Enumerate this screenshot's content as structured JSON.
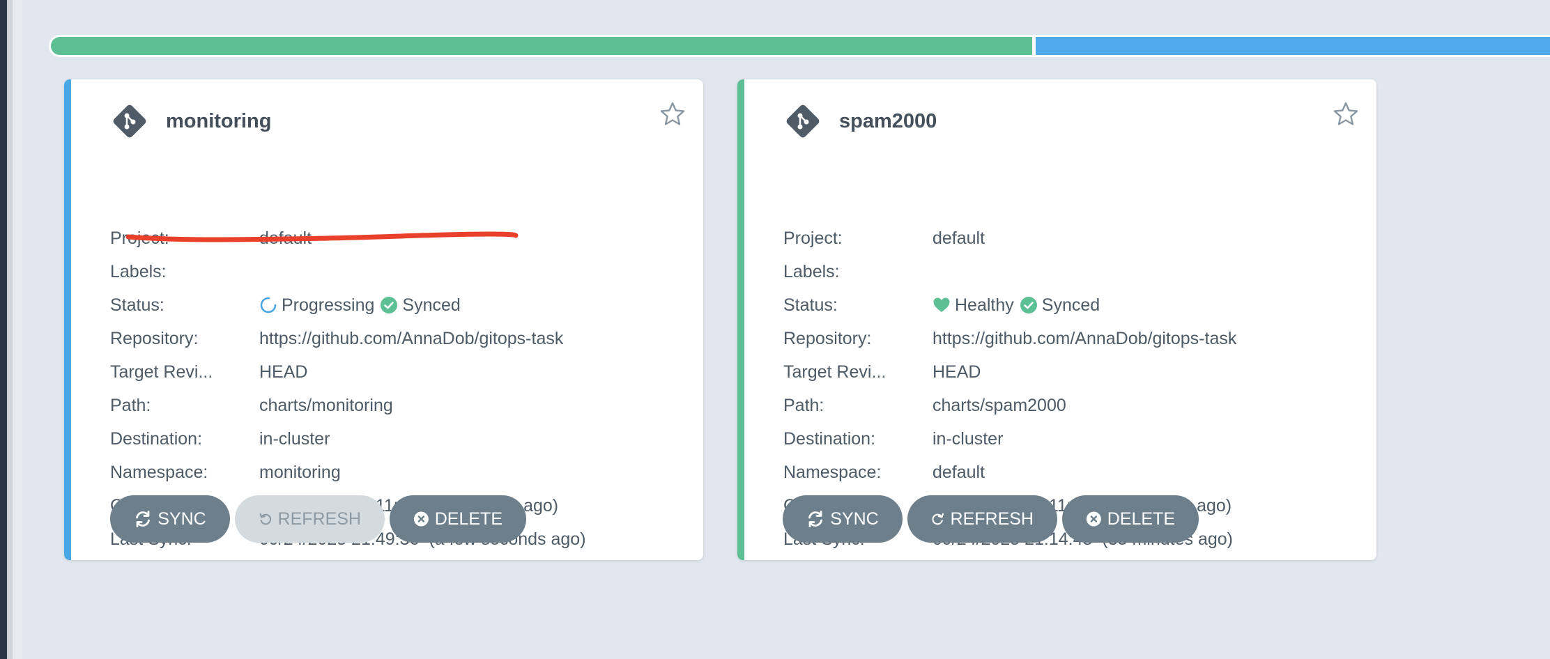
{
  "progress": {
    "segments": [
      {
        "name": "synced",
        "color": "#5dbf94",
        "fraction": 0.655
      },
      {
        "name": "other",
        "color": "#50a9e8",
        "fraction": 0.345
      }
    ]
  },
  "labels": {
    "project": "Project:",
    "labels": "Labels:",
    "status": "Status:",
    "repository": "Repository:",
    "target_revision": "Target Revi...",
    "path": "Path:",
    "destination": "Destination:",
    "namespace": "Namespace:",
    "created_at": "Created At:",
    "last_sync": "Last Sync:"
  },
  "buttons": {
    "sync": "SYNC",
    "refresh": "REFRESH",
    "delete": "DELETE"
  },
  "apps": [
    {
      "name": "monitoring",
      "accent_color": "#4ba6e5",
      "project": "default",
      "labels": "",
      "health_status": "Progressing",
      "health_icon": "progressing-spinner-icon",
      "sync_status": "Synced",
      "repository": "https://github.com/AnnaDob/gitops-task",
      "target_revision": "HEAD",
      "path": "charts/monitoring",
      "destination": "in-cluster",
      "namespace": "monitoring",
      "created_at": "09/24/2025 21:11:40",
      "created_ago": "(38 minutes ago)",
      "last_sync": "09/24/2025 21:49:36",
      "last_sync_ago": "(a few seconds ago)",
      "refresh_disabled": true
    },
    {
      "name": "spam2000",
      "accent_color": "#5dbf94",
      "project": "default",
      "labels": "",
      "health_status": "Healthy",
      "health_icon": "heart-icon",
      "sync_status": "Synced",
      "repository": "https://github.com/AnnaDob/gitops-task",
      "target_revision": "HEAD",
      "path": "charts/spam2000",
      "destination": "in-cluster",
      "namespace": "default",
      "created_at": "09/24/2025 21:11:40",
      "created_ago": "(38 minutes ago)",
      "last_sync": "09/24/2025 21:14:48",
      "last_sync_ago": "(35 minutes ago)",
      "refresh_disabled": false
    }
  ],
  "colors": {
    "sync_check": "#5dbf94",
    "healthy_heart": "#5dbf94",
    "progressing": "#4ba6e5",
    "annotation_stroke": "#e8402a"
  }
}
